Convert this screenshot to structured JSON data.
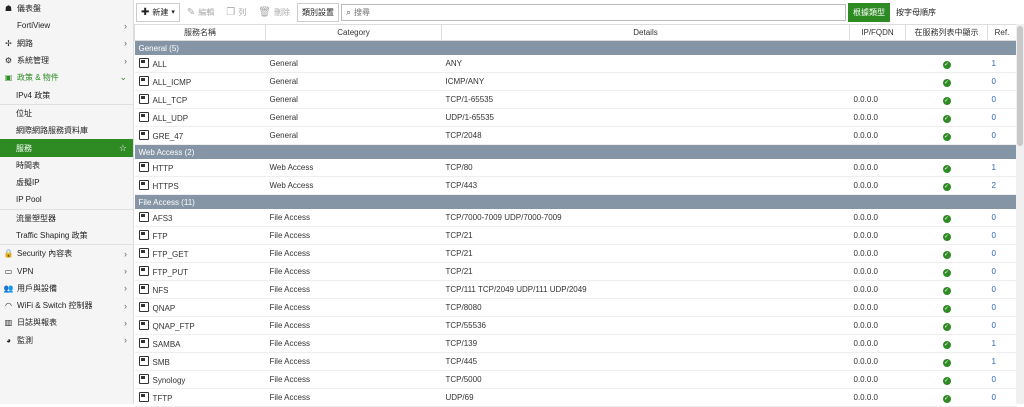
{
  "colors": {
    "accent": "#2e8b23",
    "group_row": "#8595a5",
    "link": "#2a66c4"
  },
  "sidebar": {
    "items": [
      {
        "label": "儀表盤",
        "icon": "dashboard-icon",
        "chevron": false
      },
      {
        "label": "FortiView",
        "icon": "",
        "chevron": true
      },
      {
        "label": "網路",
        "icon": "network-cross-icon",
        "chevron": true
      },
      {
        "label": "系統管理",
        "icon": "gear-icon",
        "chevron": true
      },
      {
        "label": "政策 & 物件",
        "icon": "policy-icon",
        "chevron": true,
        "expanded": true
      },
      {
        "label": "IPv4 政策",
        "sub": true
      },
      {
        "label": "位址",
        "sub": true
      },
      {
        "label": "網際網路服務資料庫",
        "sub": true
      },
      {
        "label": "服務",
        "sub": true,
        "active": true,
        "star": true
      },
      {
        "label": "時間表",
        "sub": true
      },
      {
        "label": "虛擬IP",
        "sub": true
      },
      {
        "label": "IP Pool",
        "sub": true
      },
      {
        "label": "流量塑型器",
        "sub": true
      },
      {
        "label": "Traffic Shaping 政策",
        "sub": true
      },
      {
        "label": "Security 內容表",
        "icon": "lock-icon",
        "chevron": true
      },
      {
        "label": "VPN",
        "icon": "monitor-icon",
        "chevron": true
      },
      {
        "label": "用戶與設備",
        "icon": "user-icon",
        "chevron": true
      },
      {
        "label": "WiFi & Switch 控制器",
        "icon": "wifi-icon",
        "chevron": true
      },
      {
        "label": "日誌與報表",
        "icon": "chart-icon",
        "chevron": true
      },
      {
        "label": "監測",
        "icon": "pie-icon",
        "chevron": true
      }
    ]
  },
  "toolbar": {
    "new_label": "新建",
    "edit_label": "編輯",
    "clone_label": "列",
    "delete_label": "刪除",
    "group_label": "類別設置",
    "search_placeholder": "搜尋",
    "by_type_label": "根據類型",
    "alpha_label": "按字母順序"
  },
  "table": {
    "headers": [
      "服務名稱",
      "Category",
      "Details",
      "IP/FQDN",
      "在服務列表中顯示",
      "Ref."
    ],
    "groups": [
      {
        "label": "General (5)",
        "rows": [
          {
            "name": "ALL",
            "category": "General",
            "details": "ANY",
            "ip": "",
            "ref": "1"
          },
          {
            "name": "ALL_ICMP",
            "category": "General",
            "details": "ICMP/ANY",
            "ip": "",
            "ref": "0"
          },
          {
            "name": "ALL_TCP",
            "category": "General",
            "details": "TCP/1-65535",
            "ip": "0.0.0.0",
            "ref": "0"
          },
          {
            "name": "ALL_UDP",
            "category": "General",
            "details": "UDP/1-65535",
            "ip": "0.0.0.0",
            "ref": "0"
          },
          {
            "name": "GRE_47",
            "category": "General",
            "details": "TCP/2048",
            "ip": "0.0.0.0",
            "ref": "0"
          }
        ]
      },
      {
        "label": "Web Access (2)",
        "rows": [
          {
            "name": "HTTP",
            "category": "Web Access",
            "details": "TCP/80",
            "ip": "0.0.0.0",
            "ref": "1"
          },
          {
            "name": "HTTPS",
            "category": "Web Access",
            "details": "TCP/443",
            "ip": "0.0.0.0",
            "ref": "2"
          }
        ]
      },
      {
        "label": "File Access (11)",
        "rows": [
          {
            "name": "AFS3",
            "category": "File Access",
            "details": "TCP/7000-7009  UDP/7000-7009",
            "ip": "0.0.0.0",
            "ref": "0"
          },
          {
            "name": "FTP",
            "category": "File Access",
            "details": "TCP/21",
            "ip": "0.0.0.0",
            "ref": "0"
          },
          {
            "name": "FTP_GET",
            "category": "File Access",
            "details": "TCP/21",
            "ip": "0.0.0.0",
            "ref": "0"
          },
          {
            "name": "FTP_PUT",
            "category": "File Access",
            "details": "TCP/21",
            "ip": "0.0.0.0",
            "ref": "0"
          },
          {
            "name": "NFS",
            "category": "File Access",
            "details": "TCP/111  TCP/2049  UDP/111  UDP/2049",
            "ip": "0.0.0.0",
            "ref": "0"
          },
          {
            "name": "QNAP",
            "category": "File Access",
            "details": "TCP/8080",
            "ip": "0.0.0.0",
            "ref": "0"
          },
          {
            "name": "QNAP_FTP",
            "category": "File Access",
            "details": "TCP/55536",
            "ip": "0.0.0.0",
            "ref": "0"
          },
          {
            "name": "SAMBA",
            "category": "File Access",
            "details": "TCP/139",
            "ip": "0.0.0.0",
            "ref": "1"
          },
          {
            "name": "SMB",
            "category": "File Access",
            "details": "TCP/445",
            "ip": "0.0.0.0",
            "ref": "1"
          },
          {
            "name": "Synology",
            "category": "File Access",
            "details": "TCP/5000",
            "ip": "0.0.0.0",
            "ref": "0"
          },
          {
            "name": "TFTP",
            "category": "File Access",
            "details": "UDP/69",
            "ip": "0.0.0.0",
            "ref": "0"
          }
        ]
      }
    ]
  }
}
